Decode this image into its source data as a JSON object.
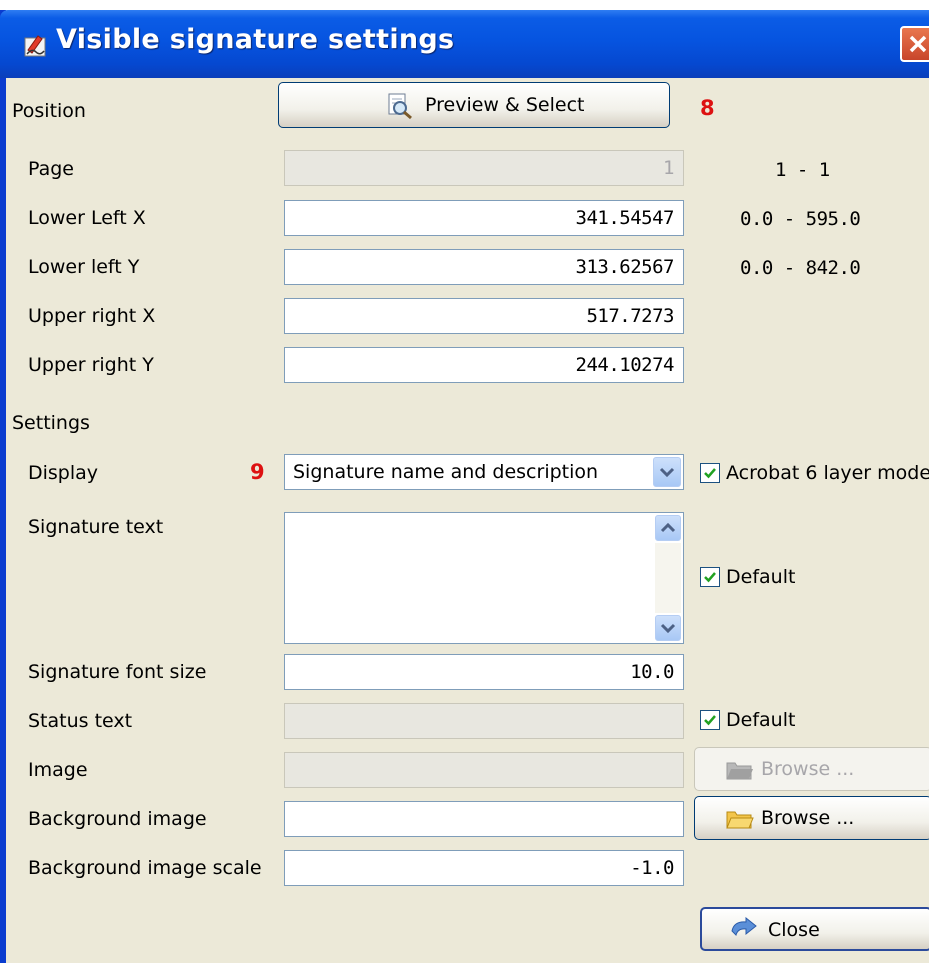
{
  "window": {
    "title": "Visible signature settings"
  },
  "position": {
    "section_label": "Position",
    "preview_button": "Preview & Select",
    "marker": "8",
    "rows": [
      {
        "label": "Page",
        "value": "1",
        "range": "1 - 1",
        "disabled": true
      },
      {
        "label": "Lower Left X",
        "value": "341.54547",
        "range": "0.0 - 595.0"
      },
      {
        "label": "Lower left Y",
        "value": "313.62567",
        "range": "0.0 - 842.0"
      },
      {
        "label": "Upper right X",
        "value": "517.7273",
        "range": ""
      },
      {
        "label": "Upper right Y",
        "value": "244.10274",
        "range": ""
      }
    ]
  },
  "settings": {
    "section_label": "Settings",
    "display_label": "Display",
    "marker": "9",
    "display_value": "Signature name and description",
    "acrobat_label": "Acrobat 6 layer mode",
    "acrobat_checked": true,
    "signature_text_label": "Signature text",
    "signature_text_value": "",
    "signature_default_label": "Default",
    "signature_default_checked": true,
    "font_size_label": "Signature font size",
    "font_size_value": "10.0",
    "status_text_label": "Status text",
    "status_text_value": "",
    "status_default_label": "Default",
    "status_default_checked": true,
    "image_label": "Image",
    "image_value": "",
    "image_browse": "Browse ...",
    "bg_image_label": "Background image",
    "bg_image_value": "",
    "bg_browse": "Browse ...",
    "bg_scale_label": "Background image scale",
    "bg_scale_value": "-1.0"
  },
  "footer": {
    "close_button": "Close"
  },
  "colors": {
    "titlebar": "#0654e0",
    "marker": "#dd1111",
    "check": "#21a121",
    "dialog_bg": "#ece9d8"
  }
}
